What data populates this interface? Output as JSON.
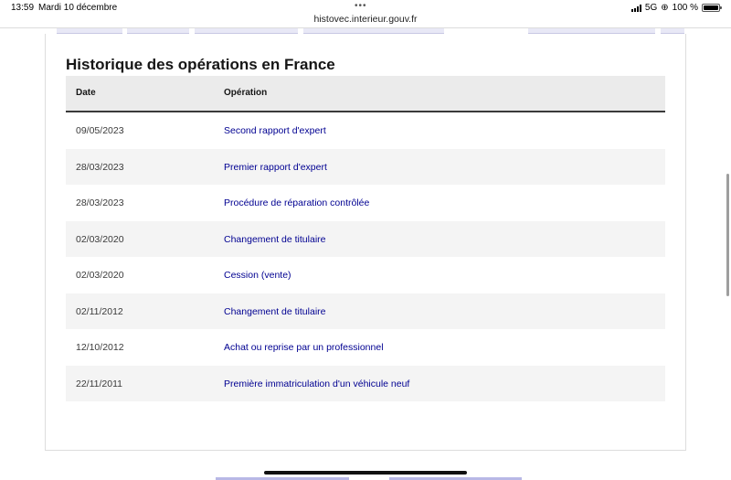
{
  "status_bar": {
    "time": "13:59",
    "date": "Mardi 10 décembre",
    "dots": "•••",
    "url": "histovec.interieur.gouv.fr",
    "network": "5G",
    "battery_text": "100 %"
  },
  "section": {
    "title": "Historique des opérations en France"
  },
  "table": {
    "headers": {
      "date": "Date",
      "operation": "Opération"
    },
    "rows": [
      {
        "date": "09/05/2023",
        "operation": "Second rapport d'expert"
      },
      {
        "date": "28/03/2023",
        "operation": "Premier rapport d'expert"
      },
      {
        "date": "28/03/2023",
        "operation": "Procédure de réparation contrôlée"
      },
      {
        "date": "02/03/2020",
        "operation": "Changement de titulaire"
      },
      {
        "date": "02/03/2020",
        "operation": "Cession (vente)"
      },
      {
        "date": "02/11/2012",
        "operation": "Changement de titulaire"
      },
      {
        "date": "12/10/2012",
        "operation": "Achat ou reprise par un professionnel"
      },
      {
        "date": "22/11/2011",
        "operation": "Première immatriculation d'un véhicule neuf"
      }
    ]
  },
  "colors": {
    "link": "#000091",
    "header_bg": "#ebebeb",
    "row_alt_bg": "#f4f4f4"
  }
}
